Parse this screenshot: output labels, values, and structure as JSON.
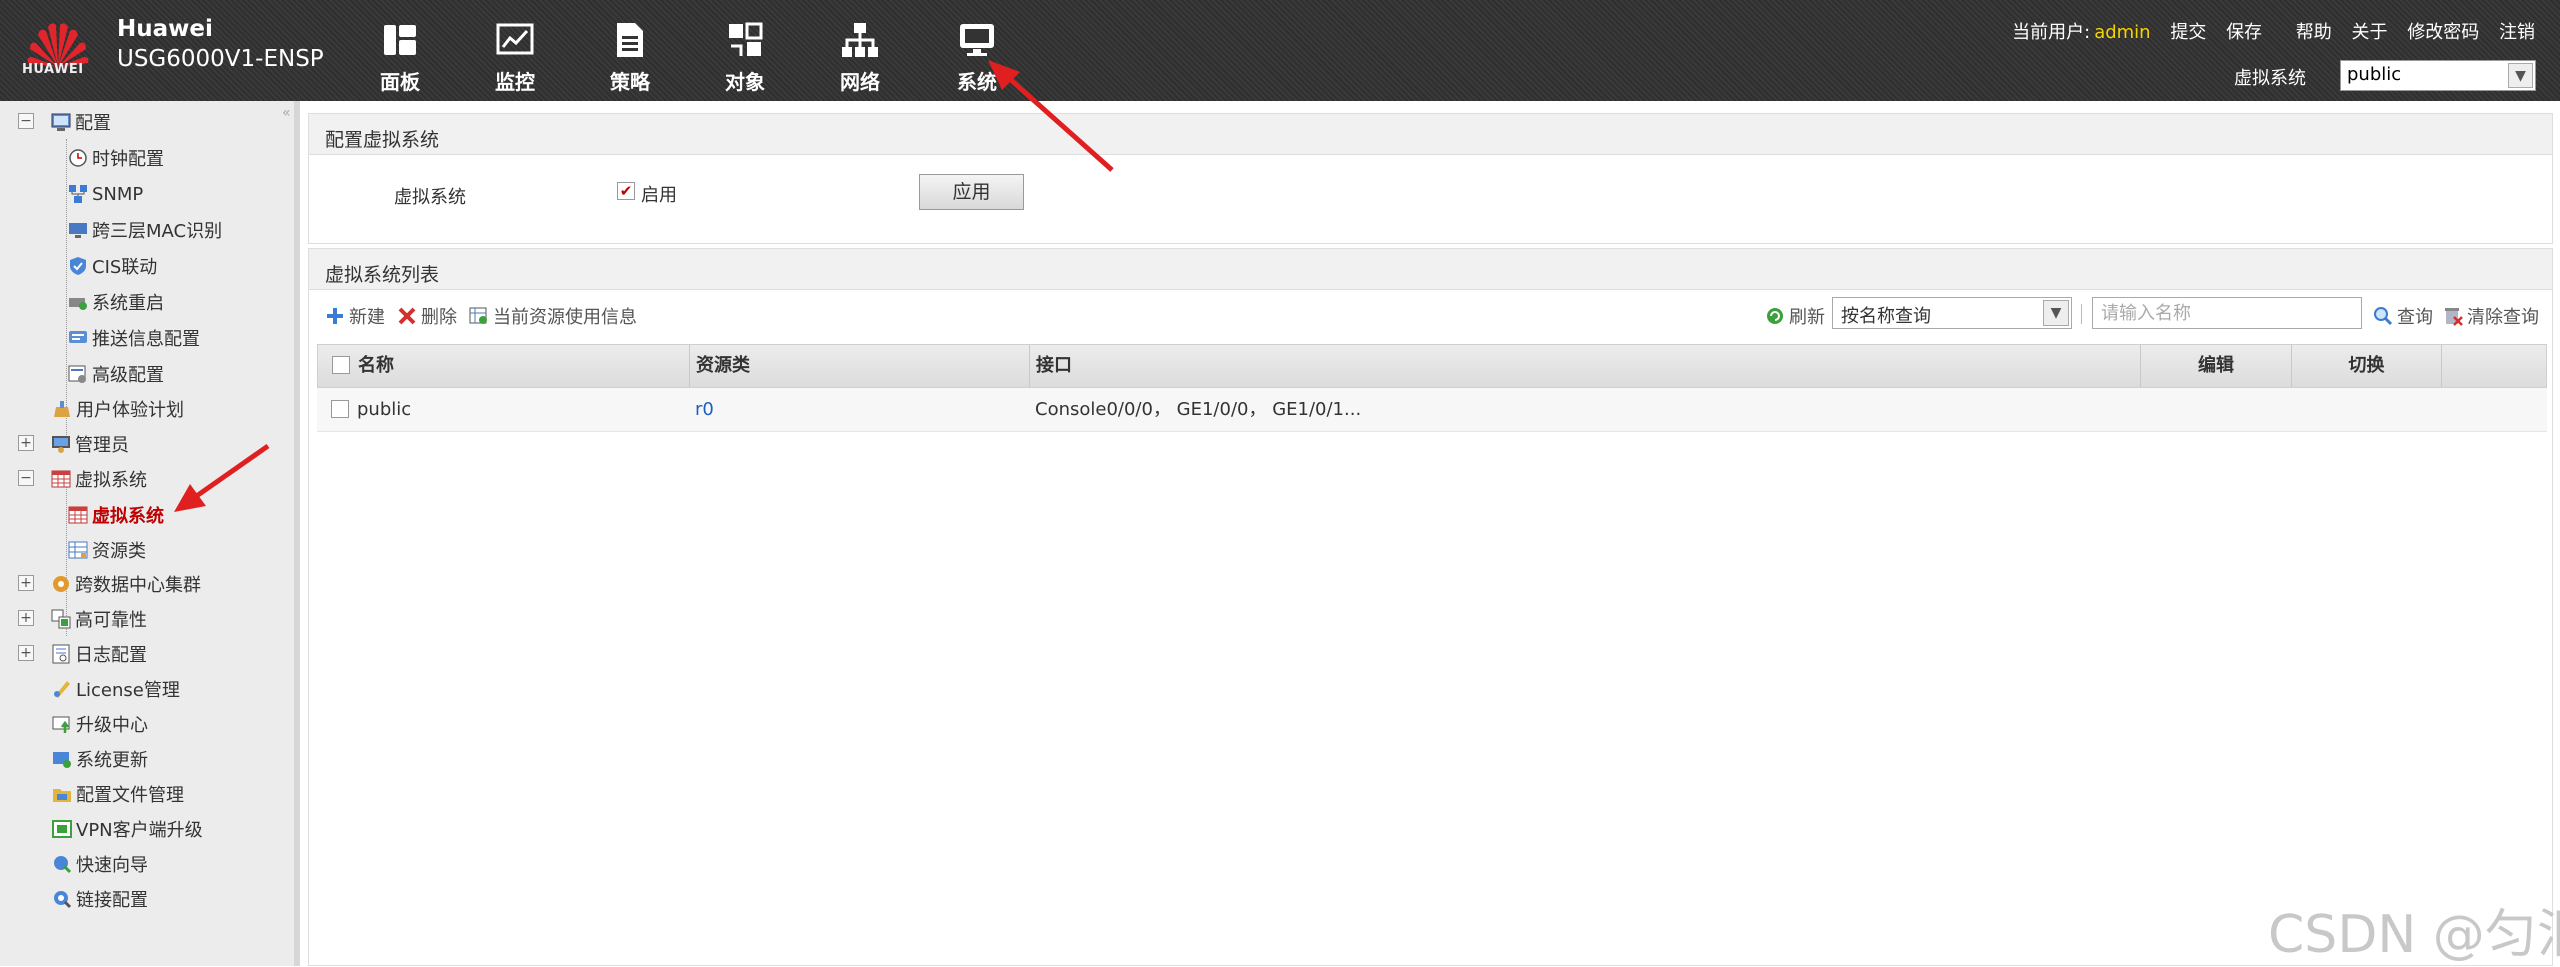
{
  "header": {
    "logo_text": "HUAWEI",
    "brand": "Huawei",
    "model": "USG6000V1-ENSP",
    "nav": [
      {
        "label": "面板",
        "icon": "dashboard-icon"
      },
      {
        "label": "监控",
        "icon": "monitor-chart-icon"
      },
      {
        "label": "策略",
        "icon": "policy-document-icon"
      },
      {
        "label": "对象",
        "icon": "object-icon"
      },
      {
        "label": "网络",
        "icon": "network-icon"
      },
      {
        "label": "系统",
        "icon": "system-monitor-icon"
      }
    ],
    "current_user_label": "当前用户:",
    "current_user": "admin",
    "links": [
      "提交",
      "保存",
      "帮助",
      "关于",
      "修改密码",
      "注销"
    ],
    "vsys_label": "虚拟系统",
    "vsys_value": "public"
  },
  "sidebar": {
    "items": [
      {
        "label": "配置",
        "icon": "config-icon",
        "expander": "−"
      },
      {
        "label": "时钟配置",
        "icon": "clock-icon"
      },
      {
        "label": "SNMP",
        "icon": "snmp-icon"
      },
      {
        "label": "跨三层MAC识别",
        "icon": "mac-icon"
      },
      {
        "label": "CIS联动",
        "icon": "cis-shield-icon"
      },
      {
        "label": "系统重启",
        "icon": "restart-icon"
      },
      {
        "label": "推送信息配置",
        "icon": "push-message-icon"
      },
      {
        "label": "高级配置",
        "icon": "advanced-config-icon"
      },
      {
        "label": "用户体验计划",
        "icon": "user-experience-icon"
      },
      {
        "label": "管理员",
        "icon": "admin-icon",
        "expander": "+"
      },
      {
        "label": "虚拟系统",
        "icon": "vsys-icon",
        "expander": "−"
      },
      {
        "label": "虚拟系统",
        "icon": "vsys-icon"
      },
      {
        "label": "资源类",
        "icon": "resource-class-icon"
      },
      {
        "label": "跨数据中心集群",
        "icon": "cluster-icon",
        "expander": "+"
      },
      {
        "label": "高可靠性",
        "icon": "reliability-icon",
        "expander": "+"
      },
      {
        "label": "日志配置",
        "icon": "log-config-icon",
        "expander": "+"
      },
      {
        "label": "License管理",
        "icon": "license-icon"
      },
      {
        "label": "升级中心",
        "icon": "upgrade-center-icon"
      },
      {
        "label": "系统更新",
        "icon": "system-update-icon"
      },
      {
        "label": "配置文件管理",
        "icon": "config-file-icon"
      },
      {
        "label": "VPN客户端升级",
        "icon": "vpn-client-icon"
      },
      {
        "label": "快速向导",
        "icon": "quick-wizard-icon"
      },
      {
        "label": "链接配置",
        "icon": "link-config-icon"
      }
    ]
  },
  "config_panel": {
    "title": "配置虚拟系统",
    "field_label": "虚拟系统",
    "checkbox_label": "启用",
    "checkbox_checked": true,
    "apply_label": "应用"
  },
  "list_panel": {
    "title": "虚拟系统列表",
    "toolbar": {
      "new_label": "新建",
      "delete_label": "删除",
      "usage_label": "当前资源使用信息",
      "refresh_label": "刷新",
      "search_mode": "按名称查询",
      "search_placeholder": "请输入名称",
      "query_label": "查询",
      "clear_label": "清除查询"
    },
    "columns": [
      "名称",
      "资源类",
      "接口",
      "编辑",
      "切换"
    ],
    "rows": [
      {
        "name": "public",
        "resource": "r0",
        "interfaces": "Console0/0/0， GE1/0/0， GE1/0/1..."
      }
    ]
  },
  "watermark": "CSDN @匀泪",
  "colors": {
    "header_bg": "#333333",
    "accent_red": "#e02020",
    "link": "#1a5fc4",
    "user_highlight": "#f5d300"
  }
}
